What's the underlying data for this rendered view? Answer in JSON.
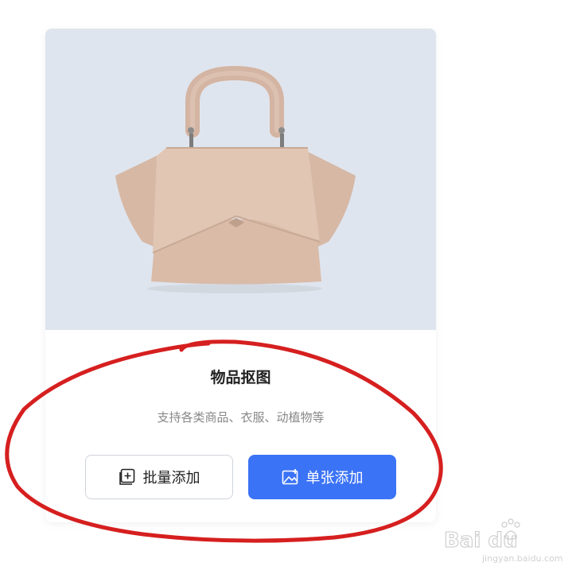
{
  "card": {
    "title": "物品抠图",
    "subtitle": "支持各类商品、衣服、动植物等",
    "batch_button_label": "批量添加",
    "single_button_label": "单张添加"
  },
  "colors": {
    "hero_background": "#dfe5ee",
    "primary_button": "#3b73f6",
    "annotation": "#d61f1f",
    "bag": "#ddbfac"
  },
  "icons": [
    "batch-add-icon",
    "image-add-icon",
    "handbag-image",
    "baidu-watermark"
  ],
  "watermark": {
    "text": "Baidu经验",
    "url": "jingyan.baidu.com"
  }
}
